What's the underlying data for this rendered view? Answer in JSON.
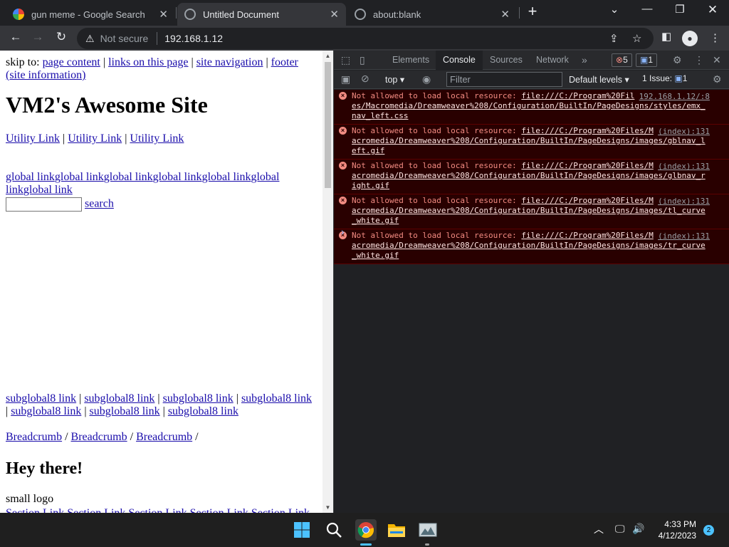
{
  "browser": {
    "tabs": [
      {
        "title": "gun meme - Google Search",
        "active": false
      },
      {
        "title": "Untitled Document",
        "active": true
      },
      {
        "title": "about:blank",
        "active": false
      }
    ],
    "new_tab": "+",
    "security": "Not secure",
    "url": "192.168.1.12"
  },
  "page": {
    "skip_label": "skip to:",
    "skip_links": [
      "page content",
      "links on this page",
      "site navigation",
      "footer (site information)"
    ],
    "site_title": "VM2's Awesome Site",
    "utility_links": [
      "Utility Link",
      "Utility Link",
      "Utility Link"
    ],
    "global_links": [
      "global link",
      "global link",
      "global link",
      "global link",
      "global link",
      "global link",
      "global link"
    ],
    "search_button": "search",
    "subglobal_links": [
      "subglobal8 link",
      "subglobal8 link",
      "subglobal8 link",
      "subglobal8 link",
      "subglobal8 link",
      "subglobal8 link",
      "subglobal8 link"
    ],
    "breadcrumbs": [
      "Breadcrumb",
      "Breadcrumb",
      "Breadcrumb"
    ],
    "heading": "Hey there!",
    "logo_alt": "small logo",
    "cut_text": "Section Link Section Link Section Link Section Link Section Link"
  },
  "devtools": {
    "tabs": [
      "Elements",
      "Console",
      "Sources",
      "Network"
    ],
    "active_tab": "Console",
    "error_count": "5",
    "message_count": "1",
    "context": "top",
    "filter_placeholder": "Filter",
    "levels": "Default levels",
    "issues_label": "1 Issue:",
    "issues_count": "1",
    "messages": [
      {
        "prefix": "Not allowed to load local resource: ",
        "url_line1": "file:///C:/Program%20Fil",
        "source": "192.168.1.12/:8",
        "url_rest": "es/Macromedia/Dreamweaver%208/Configuration/BuiltIn/PageDesigns/styles/emx_nav_left.css"
      },
      {
        "prefix": "Not allowed to load local resource: ",
        "url_line1": "file:///C:/Program%20Files/M",
        "source": "(index):131",
        "url_rest": "acromedia/Dreamweaver%208/Configuration/BuiltIn/PageDesigns/images/gblnav_left.gif"
      },
      {
        "prefix": "Not allowed to load local resource: ",
        "url_line1": "file:///C:/Program%20Files/M",
        "source": "(index):131",
        "url_rest": "acromedia/Dreamweaver%208/Configuration/BuiltIn/PageDesigns/images/glbnav_right.gif"
      },
      {
        "prefix": "Not allowed to load local resource: ",
        "url_line1": "file:///C:/Program%20Files/M",
        "source": "(index):131",
        "url_rest": "acromedia/Dreamweaver%208/Configuration/BuiltIn/PageDesigns/images/tl_curve_white.gif"
      },
      {
        "prefix": "Not allowed to load local resource: ",
        "url_line1": "file:///C:/Program%20Files/M",
        "source": "(index):131",
        "url_rest": "acromedia/Dreamweaver%208/Configuration/BuiltIn/PageDesigns/images/tr_curve_white.gif"
      }
    ]
  },
  "taskbar": {
    "time": "4:33 PM",
    "date": "4/12/2023",
    "notifications": "2"
  },
  "colors": {
    "chrome_dark": "#202124",
    "toolbar": "#35363a",
    "error_bg": "#290000",
    "error_text": "#f28b82",
    "link": "#1a0dab"
  }
}
